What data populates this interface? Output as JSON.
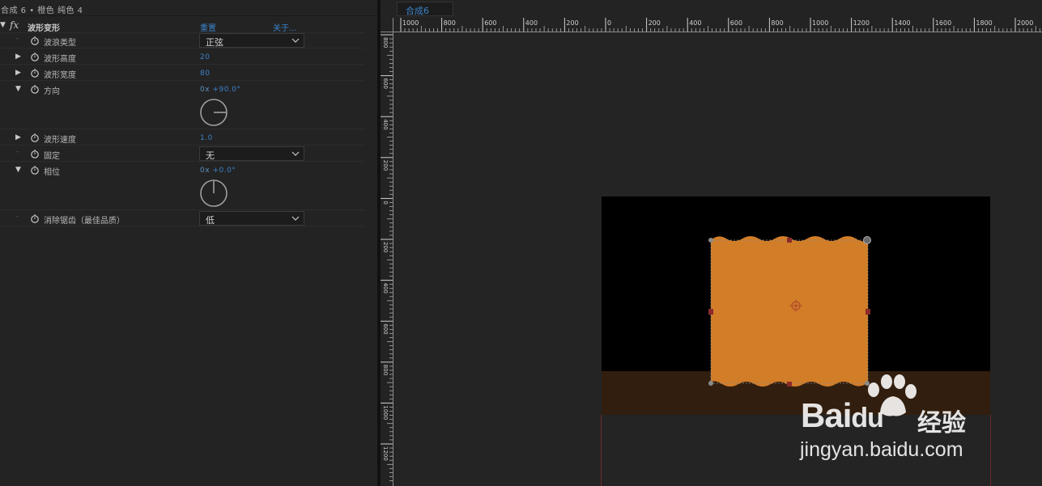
{
  "panel": {
    "header_title": "合成 6 • 橙色 纯色 4"
  },
  "effect": {
    "fx_label": "fx",
    "name": "波形变形",
    "reset_label": "重置",
    "about_label": "关于..."
  },
  "properties": {
    "wave_type": {
      "label": "波浪类型",
      "value": "正弦"
    },
    "wave_height": {
      "label": "波形高度",
      "value": "20"
    },
    "wave_width": {
      "label": "波形宽度",
      "value": "80"
    },
    "direction": {
      "label": "方向",
      "value_revs": "0x",
      "value_deg": "+90.0°",
      "angle_deg": 90
    },
    "wave_speed": {
      "label": "波形速度",
      "value": "1.0"
    },
    "pinning": {
      "label": "固定",
      "value": "无"
    },
    "phase": {
      "label": "相位",
      "value_revs": "0x",
      "value_deg": "+0.0°",
      "angle_deg": 0
    },
    "antialiasing": {
      "label": "消除锯齿（最佳品质）",
      "value": "低"
    }
  },
  "composition": {
    "tab_label": "合成6",
    "ruler_h_labels": [
      "1000",
      "800",
      "600",
      "400",
      "200",
      "0",
      "200",
      "400",
      "600",
      "800",
      "1000",
      "1200",
      "1400",
      "1600",
      "1800",
      "2000"
    ],
    "ruler_v_labels": [
      "800",
      "600",
      "400",
      "200",
      "0",
      "200",
      "400",
      "600",
      "800",
      "1000",
      "1200"
    ],
    "layer_color": "#d27d28",
    "canvas_color": "#000000",
    "ground_color": "#311e0e"
  },
  "watermark": {
    "logo_bai": "Bai",
    "logo_du": "du",
    "logo_cn": "经验",
    "url": "jingyan.baidu.com"
  },
  "icons": [
    "stopwatch-icon",
    "twirl-arrow-icon",
    "chevron-down-icon",
    "angle-dial-icon",
    "anchor-point-icon",
    "baidu-paw-icon"
  ]
}
